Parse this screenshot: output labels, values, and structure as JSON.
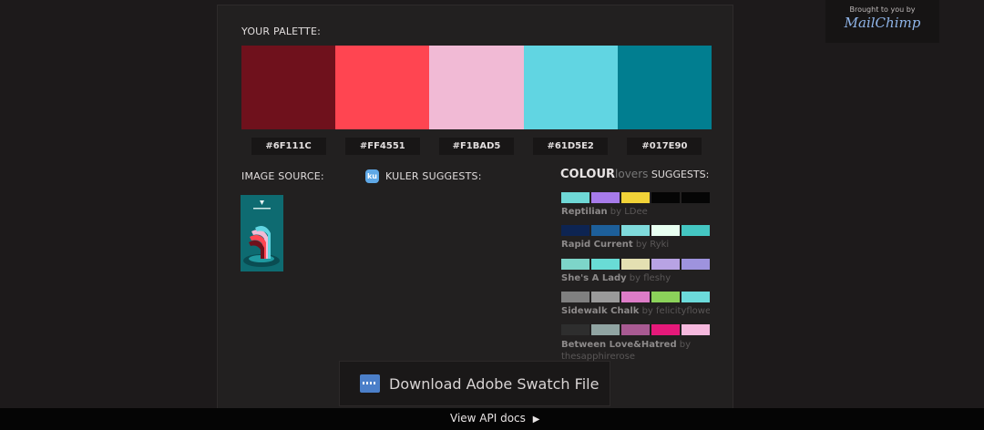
{
  "sponsor": {
    "brought_by": "Brought to you by",
    "brand": "MailChimp"
  },
  "palette": {
    "title": "YOUR PALETTE:",
    "colors": [
      "#6F111C",
      "#FF4551",
      "#F1BAD5",
      "#61D5E2",
      "#017E90"
    ],
    "hex_labels": [
      "#6F111C",
      "#FF4551",
      "#F1BAD5",
      "#61D5E2",
      "#017E90"
    ]
  },
  "image_source": {
    "title": "IMAGE SOURCE:"
  },
  "kuler": {
    "icon_text": "ku",
    "title": "KULER SUGGESTS:"
  },
  "colourlovers": {
    "logo_bold": "COLOUR",
    "logo_light": "lovers",
    "title_suffix": " SUGGESTS:",
    "suggestions": [
      {
        "name": "Reptilian",
        "by": " by LDee",
        "colors": [
          "#6FD8D6",
          "#A77BEA",
          "#F2D338",
          "#050505",
          "#050505"
        ]
      },
      {
        "name": "Rapid Current",
        "by": " by Ryki",
        "colors": [
          "#0D2452",
          "#1D5F9A",
          "#7FDADB",
          "#E8FFF1",
          "#44C6C2"
        ]
      },
      {
        "name": "She's A Lady",
        "by": " by fleshy",
        "colors": [
          "#7DD5C9",
          "#69DCD6",
          "#E4E0B2",
          "#B8A3E4",
          "#9E93DE"
        ]
      },
      {
        "name": "Sidewalk Chalk",
        "by": " by felicityflowers",
        "colors": [
          "#808080",
          "#9A9A9A",
          "#DD7CC7",
          "#8BD25A",
          "#6CDADA"
        ]
      },
      {
        "name": "Between Love&Hatred",
        "by": " by thesapphirerose",
        "colors": [
          "#2E2E2E",
          "#90A4A2",
          "#A85A92",
          "#E5197A",
          "#F6B9DE"
        ]
      }
    ]
  },
  "download": {
    "label": "Download Adobe Swatch File"
  },
  "footer": {
    "api_link": "View API docs",
    "arrow": "▶"
  }
}
